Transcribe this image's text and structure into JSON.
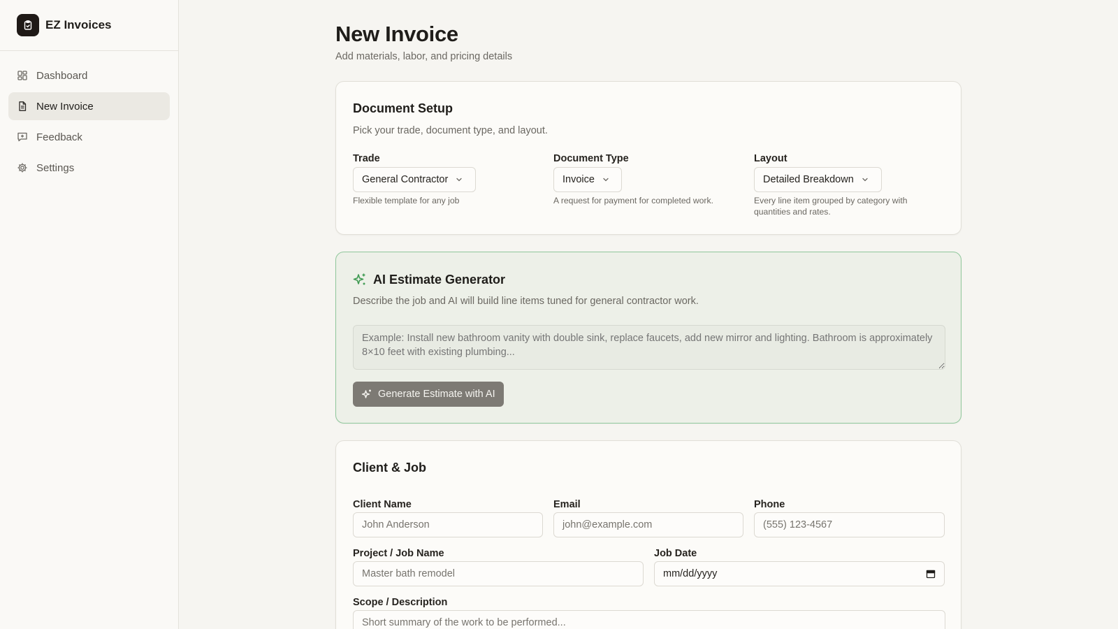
{
  "app": {
    "name": "EZ Invoices"
  },
  "sidebar": {
    "items": [
      {
        "label": "Dashboard",
        "icon": "dashboard-grid-icon",
        "active": false
      },
      {
        "label": "New Invoice",
        "icon": "document-icon",
        "active": true
      },
      {
        "label": "Feedback",
        "icon": "message-plus-icon",
        "active": false
      },
      {
        "label": "Settings",
        "icon": "gear-icon",
        "active": false
      }
    ]
  },
  "page": {
    "title": "New Invoice",
    "subtitle": "Add materials, labor, and pricing details"
  },
  "document_setup": {
    "title": "Document Setup",
    "description": "Pick your trade, document type, and layout.",
    "trade": {
      "label": "Trade",
      "value": "General Contractor",
      "hint": "Flexible template for any job"
    },
    "document_type": {
      "label": "Document Type",
      "value": "Invoice",
      "hint": "A request for payment for completed work."
    },
    "layout": {
      "label": "Layout",
      "value": "Detailed Breakdown",
      "hint": "Every line item grouped by category with quantities and rates."
    }
  },
  "ai_generator": {
    "title": "AI Estimate Generator",
    "description": "Describe the job and AI will build line items tuned for general contractor work.",
    "placeholder": "Example: Install new bathroom vanity with double sink, replace faucets, add new mirror and lighting. Bathroom is approximately 8×10 feet with existing plumbing...",
    "button_label": "Generate Estimate with AI",
    "accent_color": "#3f9a52"
  },
  "client_job": {
    "title": "Client & Job",
    "client_name": {
      "label": "Client Name",
      "placeholder": "John Anderson"
    },
    "email": {
      "label": "Email",
      "placeholder": "john@example.com"
    },
    "phone": {
      "label": "Phone",
      "placeholder": "(555) 123-4567"
    },
    "project_name": {
      "label": "Project / Job Name",
      "placeholder": "Master bath remodel"
    },
    "job_date": {
      "label": "Job Date",
      "value": "mm/dd/yyyy"
    },
    "scope": {
      "label": "Scope / Description",
      "placeholder": "Short summary of the work to be performed..."
    }
  }
}
